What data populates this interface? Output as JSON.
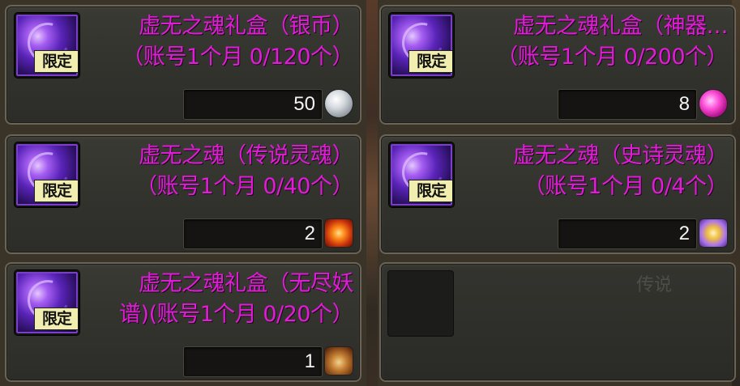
{
  "badge_text": "限定",
  "items": [
    {
      "title": "虚无之魂礼盒（银币）\n（账号1个月 0/120个）",
      "price": "50",
      "currency_icon": "silver-coin-icon"
    },
    {
      "title": "虚无之魂礼盒（神器…\n（账号1个月 0/200个）",
      "price": "8",
      "currency_icon": "pink-orb-icon"
    },
    {
      "title": "虚无之魂（传说灵魂）\n（账号1个月 0/40个）",
      "price": "2",
      "currency_icon": "fire-soul-icon"
    },
    {
      "title": "虚无之魂（史诗灵魂）\n（账号1个月 0/4个）",
      "price": "2",
      "currency_icon": "epic-soul-icon"
    },
    {
      "title": "虚无之魂礼盒（无尽妖\n谱)(账号1个月 0/20个）",
      "price": "1",
      "currency_icon": "pouch-icon"
    }
  ],
  "background_text": "传说",
  "colors": {
    "title": "#e21bd8",
    "price": "#f4f4f4",
    "slot_border": "#6b6355"
  }
}
